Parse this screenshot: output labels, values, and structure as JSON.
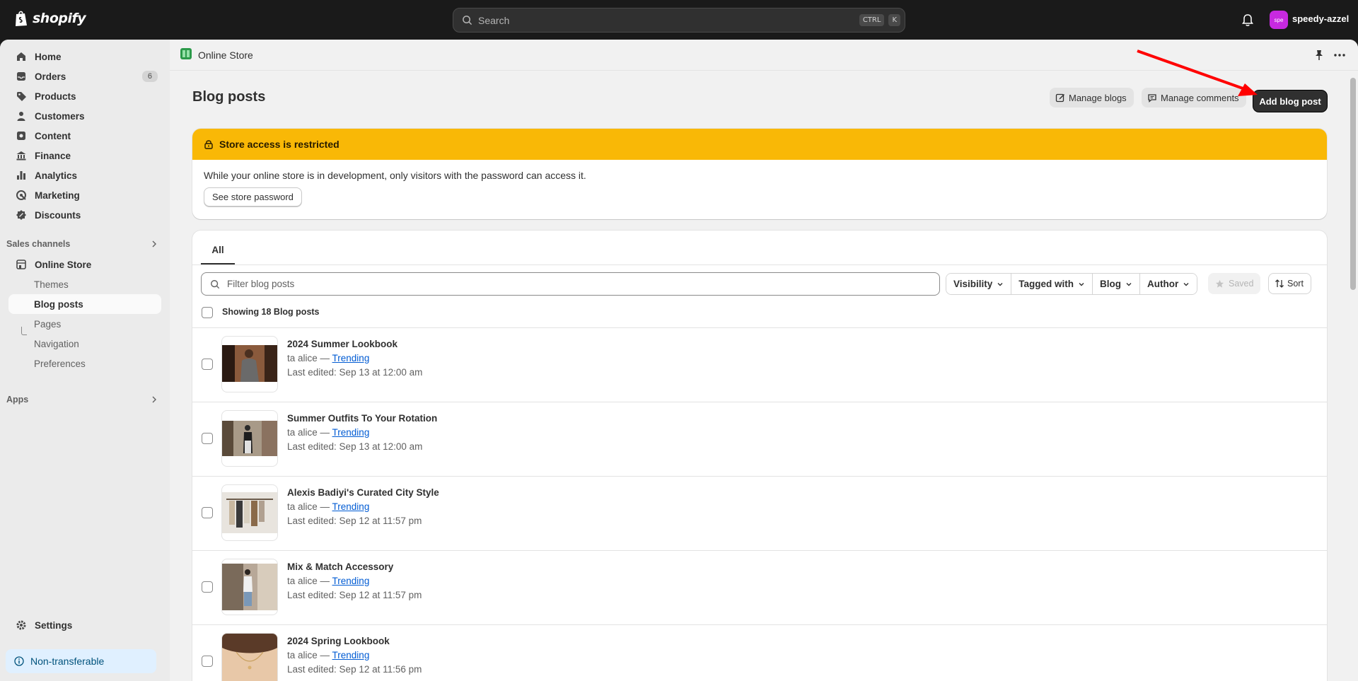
{
  "topbar": {
    "logo_text": "shopify",
    "search_placeholder": "Search",
    "shortcut_ctrl": "CTRL",
    "shortcut_key": "K",
    "store_initials": "spe",
    "store_name": "speedy-azzel"
  },
  "sidebar": {
    "items": [
      {
        "label": "Home",
        "icon": "home-icon"
      },
      {
        "label": "Orders",
        "icon": "inbox-icon",
        "badge": "6"
      },
      {
        "label": "Products",
        "icon": "tag-icon"
      },
      {
        "label": "Customers",
        "icon": "person-icon"
      },
      {
        "label": "Content",
        "icon": "content-icon"
      },
      {
        "label": "Finance",
        "icon": "bank-icon"
      },
      {
        "label": "Analytics",
        "icon": "bar-chart-icon"
      },
      {
        "label": "Marketing",
        "icon": "target-icon"
      },
      {
        "label": "Discounts",
        "icon": "discount-icon"
      }
    ],
    "sales_channels_label": "Sales channels",
    "online_store_label": "Online Store",
    "sub_items": [
      "Themes",
      "Blog posts",
      "Pages",
      "Navigation",
      "Preferences"
    ],
    "apps_label": "Apps",
    "settings_label": "Settings",
    "nontransferable_label": "Non-transferable"
  },
  "breadcrumb": {
    "label": "Online Store"
  },
  "page": {
    "title": "Blog posts",
    "manage_blogs": "Manage blogs",
    "manage_comments": "Manage comments",
    "add_blog_post": "Add blog post"
  },
  "banner": {
    "title": "Store access is restricted",
    "message": "While your online store is in development, only visitors with the password can access it.",
    "button": "See store password",
    "color": "#f9b806"
  },
  "list": {
    "tab": "All",
    "filter_placeholder": "Filter blog posts",
    "filters": [
      "Visibility",
      "Tagged with",
      "Blog",
      "Author"
    ],
    "saved": "Saved",
    "sort": "Sort",
    "showing": "Showing 18 Blog posts",
    "rows": [
      {
        "title": "2024 Summer Lookbook",
        "author": "ta alice — ",
        "tag": "Trending",
        "edited": "Last edited: Sep 13 at 12:00 am"
      },
      {
        "title": "Summer Outfits To Your Rotation",
        "author": "ta alice — ",
        "tag": "Trending",
        "edited": "Last edited: Sep 13 at 12:00 am"
      },
      {
        "title": "Alexis Badiyi's Curated City Style",
        "author": "ta alice — ",
        "tag": "Trending",
        "edited": "Last edited: Sep 12 at 11:57 pm"
      },
      {
        "title": "Mix & Match Accessory",
        "author": "ta alice — ",
        "tag": "Trending",
        "edited": "Last edited: Sep 12 at 11:57 pm"
      },
      {
        "title": "2024 Spring Lookbook",
        "author": "ta alice — ",
        "tag": "Trending",
        "edited": "Last edited: Sep 12 at 11:56 pm"
      }
    ]
  },
  "colors": {
    "accent_arrow": "#ff0000",
    "link": "#005bd3",
    "primary_button": "#303030"
  }
}
